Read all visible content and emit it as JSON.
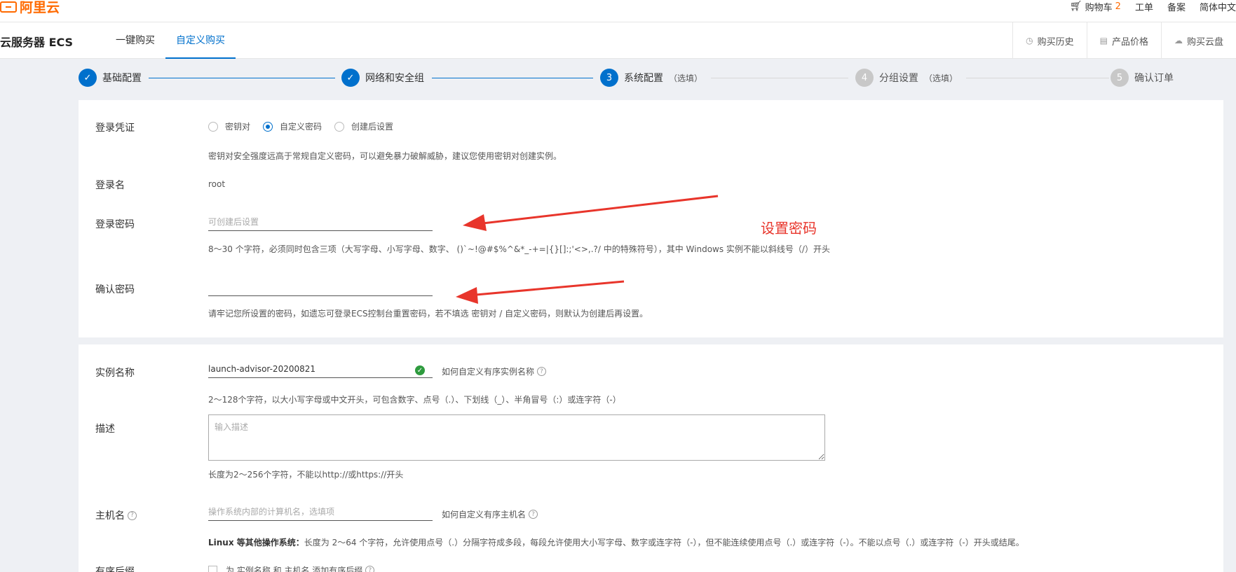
{
  "topbar": {
    "logo_text": "阿里云",
    "cart_label": "购物车",
    "cart_count": "2",
    "ticket": "工单",
    "filing": "备案",
    "language": "简体中文"
  },
  "product": {
    "title": "云服务器 ECS",
    "tabs": [
      {
        "label": "一键购买"
      },
      {
        "label": "自定义购买"
      }
    ],
    "right_links": [
      {
        "label": "购买历史"
      },
      {
        "label": "产品价格"
      },
      {
        "label": "购买云盘"
      }
    ]
  },
  "steps": [
    {
      "number": "✓",
      "label": "基础配置",
      "optional": ""
    },
    {
      "number": "✓",
      "label": "网络和安全组",
      "optional": ""
    },
    {
      "number": "3",
      "label": "系统配置",
      "optional": "（选填）"
    },
    {
      "number": "4",
      "label": "分组设置",
      "optional": "（选填）"
    },
    {
      "number": "5",
      "label": "确认订单",
      "optional": ""
    }
  ],
  "login": {
    "credential_label": "登录凭证",
    "options": [
      {
        "label": "密钥对"
      },
      {
        "label": "自定义密码"
      },
      {
        "label": "创建后设置"
      }
    ],
    "credential_hint": "密钥对安全强度远高于常规自定义密码，可以避免暴力破解威胁，建议您使用密钥对创建实例。",
    "username_label": "登录名",
    "username_value": "root",
    "password_label": "登录密码",
    "password_placeholder": "可创建后设置",
    "password_hint": "8～30 个字符，必须同时包含三项（大写字母、小写字母、数字、 ()`~!@#$%^&*_-+=|{}[]:;'<>,.?/ 中的特殊符号），其中 Windows 实例不能以斜线号（/）开头",
    "confirm_label": "确认密码",
    "confirm_hint": "请牢记您所设置的密码，如遗忘可登录ECS控制台重置密码，若不填选 密钥对 / 自定义密码，则默认为创建后再设置。"
  },
  "instance": {
    "name_label": "实例名称",
    "name_value": "launch-advisor-20200821",
    "name_link": "如何自定义有序实例名称",
    "name_hint": "2～128个字符，以大小写字母或中文开头，可包含数字、点号（.）、下划线（_）、半角冒号（:）或连字符（-）",
    "desc_label": "描述",
    "desc_placeholder": "输入描述",
    "desc_hint": "长度为2～256个字符，不能以http://或https://开头",
    "host_label": "主机名",
    "host_placeholder": "操作系统内部的计算机名，选填项",
    "host_link": "如何自定义有序主机名",
    "host_hint_bold": "Linux 等其他操作系统：",
    "host_hint": "长度为 2～64 个字符，允许使用点号（.）分隔字符成多段，每段允许使用大小写字母、数字或连字符（-），但不能连续使用点号（.）或连字符（-）。不能以点号（.）或连字符（-）开头或结尾。",
    "suffix_label": "有序后缀",
    "suffix_option": "为 实例名称 和 主机名 添加有序后缀"
  },
  "annotation": {
    "text": "设置密码",
    "color": "#e8352b"
  }
}
